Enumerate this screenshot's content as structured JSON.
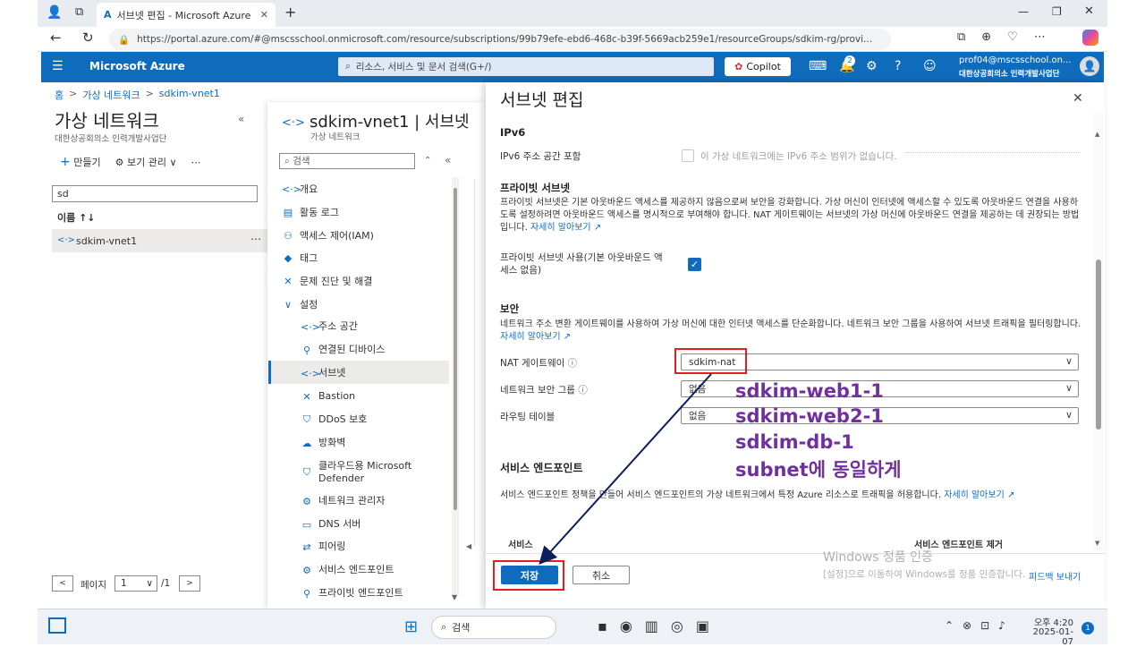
{
  "browser": {
    "tab_title": "서브넷 편집 - Microsoft Azure",
    "url": "https://portal.azure.com/#@mscsschool.onmicrosoft.com/resource/subscriptions/99b79efe-ebd6-468c-b39f-5669acb259e1/resourceGroups/sdkim-rg/provi..."
  },
  "topbar": {
    "brand": "Microsoft Azure",
    "search_placeholder": "리소스, 서비스 및 문서 검색(G+/)",
    "copilot": "Copilot",
    "notif_count": "2",
    "account_name": "prof04@mscsschool.on...",
    "account_org": "대한상공회의소 인력개발사업단"
  },
  "breadcrumb": {
    "home": "홈",
    "sep": ">",
    "vnet": "가상 네트워크",
    "item": "sdkim-vnet1"
  },
  "left": {
    "title": "가상 네트워크",
    "subtitle": "대한상공회의소 인력개발사업단",
    "create": "만들기",
    "manage_view": "보기 관리",
    "filter_value": "sd",
    "col_name": "이름 ↑↓",
    "row1": "sdkim-vnet1",
    "page_label": "페이지",
    "page_value": "1",
    "page_total": "/1"
  },
  "resource": {
    "title": "sdkim-vnet1 | 서브넷",
    "subtitle": "가상 네트워크",
    "search_placeholder": "검색",
    "nav": [
      {
        "label": "개요",
        "icon": "<·>"
      },
      {
        "label": "활동 로그",
        "icon": "▤"
      },
      {
        "label": "액세스 제어(IAM)",
        "icon": "⚇"
      },
      {
        "label": "태그",
        "icon": "◆"
      },
      {
        "label": "문제 진단 및 해결",
        "icon": "✕"
      },
      {
        "label": "설정",
        "icon": "∨"
      }
    ],
    "subnav": [
      {
        "label": "주소 공간",
        "icon": "<·>"
      },
      {
        "label": "연결된 디바이스",
        "icon": "⚲"
      },
      {
        "label": "서브넷",
        "icon": "<·>"
      },
      {
        "label": "Bastion",
        "icon": "✕"
      },
      {
        "label": "DDoS 보호",
        "icon": "⛉"
      },
      {
        "label": "방화벽",
        "icon": "☁"
      },
      {
        "label": "클라우드용 Microsoft",
        "label2": "Defender",
        "icon": "⛉"
      },
      {
        "label": "네트워크 관리자",
        "icon": "⚙"
      },
      {
        "label": "DNS 서버",
        "icon": "▭"
      },
      {
        "label": "피어링",
        "icon": "⇄"
      },
      {
        "label": "서비스 엔드포인트",
        "icon": "⚙"
      },
      {
        "label": "프라이빗 엔드포인트",
        "icon": "⚲"
      }
    ]
  },
  "blade": {
    "title": "서브넷 편집",
    "ipv6_heading": "IPv6",
    "ipv6_label": "IPv6 주소 공간 포함",
    "ipv6_note": "이 가상 네트워크에는 IPv6 주소 범위가 없습니다.",
    "private_heading": "프라이빗 서브넷",
    "private_desc": "프라이빗 서브넷은 기본 아웃바운드 액세스를 제공하지 않음으로써 보안을 강화합니다. 가상 머신이 인터넷에 액세스할 수 있도록 아웃바운드 연결을 사용하도록 설정하려면 아웃바운드 액세스를 명시적으로 부여해야 합니다. NAT 게이트웨이는 서브넷의 가상 머신에 아웃바운드 연결을 제공하는 데 권장되는 방법입니다.",
    "learn_more": "자세히 알아보기 ↗",
    "private_enable": "프라이빗 서브넷 사용(기본 아웃바운드 액",
    "private_enable2": "세스 없음)",
    "security_heading": "보안",
    "security_desc": "네트워크 주소 변환 게이트웨이를 사용하여 가상 머신에 대한 인터넷 액세스를 단순화합니다. 네트워크 보안 그룹을 사용하여 서브넷 트래픽을 필터링합니다.",
    "nat_label": "NAT 게이트웨이",
    "nat_value": "sdkim-nat",
    "nsg_label": "네트워크 보안 그룹",
    "nsg_value": "없음",
    "route_label": "라우팅 테이블",
    "route_value": "없음",
    "svc_heading": "서비스 엔드포인트",
    "svc_desc": "서비스 엔드포인트 정책을 만들어 서비스 엔드포인트의 가상 네트워크에서 특정 Azure 리소스로 트래픽을 허용합니다.",
    "col_service": "서비스",
    "col_remove": "서비스 엔드포인트 제거",
    "save": "저장",
    "cancel": "취소",
    "feedback": "피드백 보내기"
  },
  "annotation": {
    "line1": "sdkim-web1-1",
    "line2": "sdkim-web2-1",
    "line3": "sdkim-db-1",
    "line4": "subnet에 동일하게"
  },
  "watermark": {
    "line1": "Windows 정품 인증",
    "line2": "[설정]으로 이동하여 Windows를 정품 인증합니다."
  },
  "taskbar": {
    "search": "검색",
    "time": "오후 4:20",
    "date": "2025-01-07",
    "badge": "1"
  }
}
